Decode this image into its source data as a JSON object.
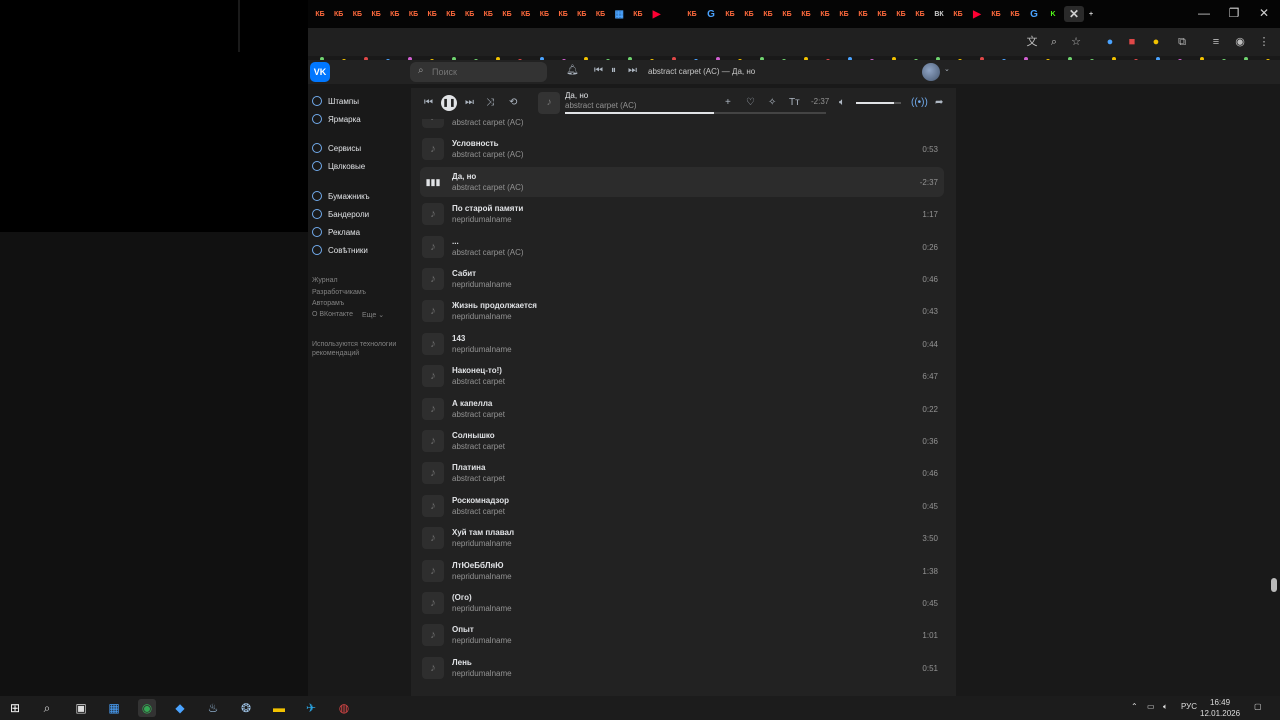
{
  "browser": {
    "tab_glyphs": {
      "kf": "КБ",
      "youtube": "▶",
      "google": "G",
      "vk": "ВК",
      "k": "K",
      "close": "✕",
      "new": "+"
    }
  },
  "vk": {
    "logo": "VK",
    "search_placeholder": "Поиск",
    "now_playing_header": "abstract carpet (AC) — Да, но",
    "colors": {
      "brand": "#0077ff",
      "bg": "#191919",
      "panel": "#222222"
    }
  },
  "sidebar": {
    "items": [
      "Штампы",
      "Ярмарка",
      "Сервисы",
      "Цвлковые",
      "Бумажникъ",
      "Бандероли",
      "Реклама",
      "Совѣтники"
    ],
    "footer": [
      "Журнал",
      "Разработчикамъ",
      "Авторамъ",
      "О ВКонтакте",
      "Еще ⌄"
    ],
    "note": [
      "Используются технологии",
      "рекомендаций"
    ]
  },
  "player": {
    "title": "Да, но",
    "artist": "abstract carpet (AC)",
    "time": "-2:37",
    "progress": 0.57,
    "volume": 0.85
  },
  "tracks": [
    {
      "title": "",
      "artist": "abstract carpet (AC)",
      "duration": ""
    },
    {
      "title": "Условность",
      "artist": "abstract carpet (AC)",
      "duration": "0:53"
    },
    {
      "title": "Да, но",
      "artist": "abstract carpet (AC)",
      "duration": "-2:37",
      "current": true
    },
    {
      "title": "По старой памяти",
      "artist": "nepridumalname",
      "duration": "1:17"
    },
    {
      "title": "...",
      "artist": "abstract carpet (AC)",
      "duration": "0:26"
    },
    {
      "title": "Сабит",
      "artist": "nepridumalname",
      "duration": "0:46"
    },
    {
      "title": "Жизнь продолжается",
      "artist": "nepridumalname",
      "duration": "0:43"
    },
    {
      "title": "143",
      "artist": "nepridumalname",
      "duration": "0:44"
    },
    {
      "title": "Наконец-то!)",
      "artist": "abstract carpet",
      "duration": "6:47"
    },
    {
      "title": "А капелла",
      "artist": "abstract carpet",
      "duration": "0:22"
    },
    {
      "title": "Солнышко",
      "artist": "abstract carpet",
      "duration": "0:36"
    },
    {
      "title": "Платина",
      "artist": "abstract carpet",
      "duration": "0:46"
    },
    {
      "title": "Роскомнадзор",
      "artist": "abstract carpet",
      "duration": "0:45"
    },
    {
      "title": "Хуй там плавал",
      "artist": "nepridumalname",
      "duration": "3:50"
    },
    {
      "title": "ЛтЮеБбЛяЮ",
      "artist": "nepridumalname",
      "duration": "1:38"
    },
    {
      "title": "(Ого)",
      "artist": "nepridumalname",
      "duration": "0:45"
    },
    {
      "title": "Опыт",
      "artist": "nepridumalname",
      "duration": "1:01"
    },
    {
      "title": "Лень",
      "artist": "nepridumalname",
      "duration": "0:51"
    }
  ],
  "taskbar": {
    "lang": "РУС",
    "time": "16:49",
    "date": "12.01.2026"
  }
}
